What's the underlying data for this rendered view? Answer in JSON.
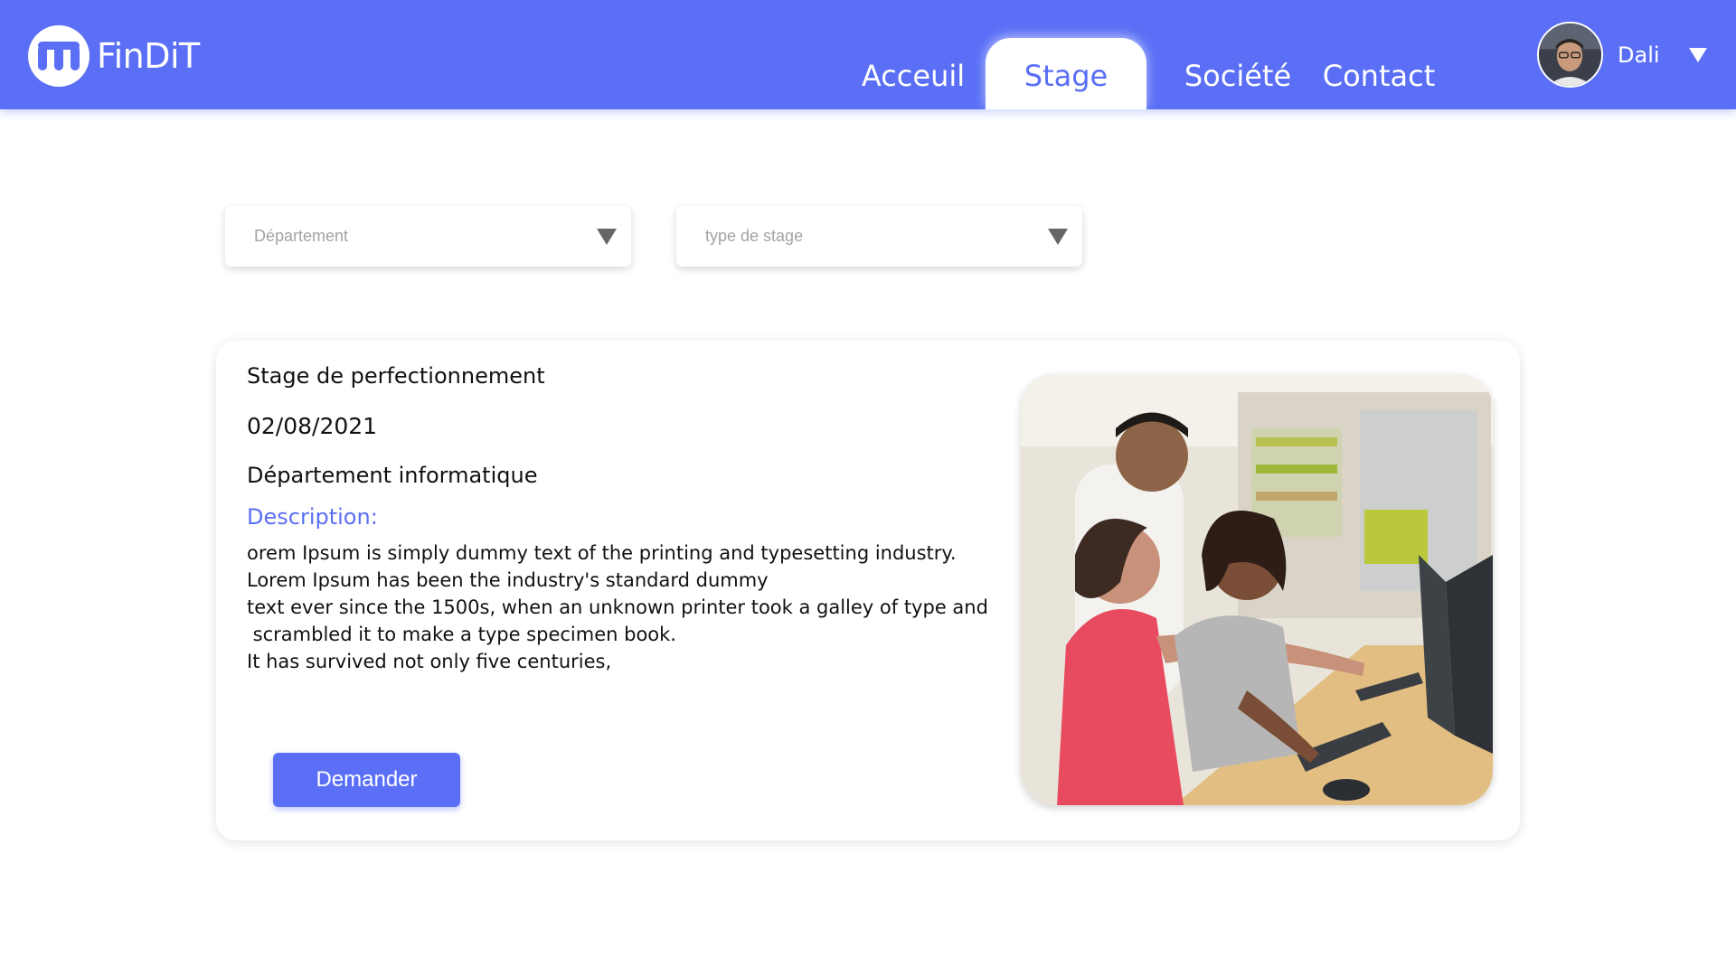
{
  "brand": {
    "name": "FinDiT"
  },
  "nav": {
    "items": [
      {
        "label": "Acceuil",
        "active": false
      },
      {
        "label": "Stage",
        "active": true
      },
      {
        "label": "Société",
        "active": false
      },
      {
        "label": "Contact",
        "active": false
      }
    ]
  },
  "user": {
    "name": "Dali"
  },
  "filters": {
    "department": {
      "placeholder": "Département"
    },
    "stage_type": {
      "placeholder": "type de stage"
    }
  },
  "offer": {
    "title": "Stage de perfectionnement",
    "date": "02/08/2021",
    "department": "Département informatique",
    "description_label": "Description:",
    "description_lines": [
      "orem Ipsum is simply dummy text of the printing and typesetting industry.",
      "Lorem Ipsum has been the industry's standard dummy",
      "text ever since the 1500s, when an unknown printer took a galley of type and",
      " scrambled it to make a type specimen book.",
      "It has survived not only five centuries,"
    ],
    "action_label": "Demander"
  },
  "colors": {
    "primary": "#5a6ff5",
    "text": "#111111",
    "placeholder": "#a3a3a3"
  },
  "icons": {
    "logo": "findit-logo-icon",
    "user_menu": "caret-down-icon",
    "select": "caret-down-icon"
  }
}
